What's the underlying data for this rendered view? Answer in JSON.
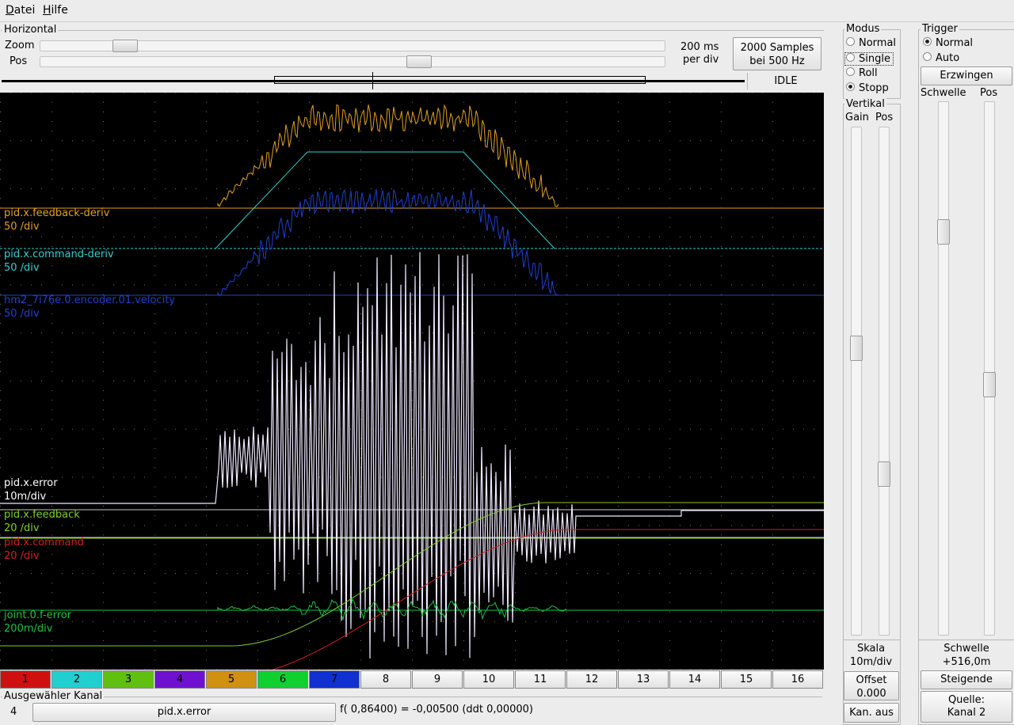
{
  "menu": {
    "datei": "Datei",
    "hilfe": "Hilfe"
  },
  "horizontal": {
    "title": "Horizontal",
    "zoom_label": "Zoom",
    "pos_label": "Pos",
    "zoom_level": 0.12,
    "pos_level": 0.61,
    "time_per_div_line1": "200 ms",
    "time_per_div_line2": "per div",
    "samples_line1": "2000 Samples",
    "samples_line2": "bei 500 Hz",
    "status": "IDLE"
  },
  "modus": {
    "title": "Modus",
    "options": [
      "Normal",
      "Single",
      "Roll",
      "Stopp"
    ],
    "selected": "Stopp"
  },
  "trigger": {
    "title": "Trigger",
    "options": [
      "Normal",
      "Auto"
    ],
    "selected": "Normal",
    "force_button": "Erzwingen",
    "threshold_label": "Schwelle",
    "pos_label": "Pos",
    "threshold_level": 0.77,
    "pos_level": 0.53,
    "threshold_title": "Schwelle",
    "threshold_value": "+516,0m",
    "edge_button": "Steigende",
    "source_line1": "Quelle:",
    "source_line2": "Kanal  2"
  },
  "vertikal": {
    "title": "Vertikal",
    "gain_label": "Gain",
    "pos_label": "Pos",
    "gain_level": 0.43,
    "pos_level": 0.69,
    "scale_label": "Skala",
    "scale_value": "10m/div",
    "offset_label": "Offset",
    "offset_value": "0.000",
    "channel_off_button": "Kan. aus"
  },
  "traces": [
    {
      "name": "pid.x.feedback-deriv",
      "scale": "50 /div",
      "color": "#e0a020"
    },
    {
      "name": "pid.x.command-deriv",
      "scale": "50 /div",
      "color": "#30d0d0"
    },
    {
      "name": "hm2_7i76e.0.encoder.01.velocity",
      "scale": "50 /div",
      "color": "#2040d0"
    },
    {
      "name": "pid.x.error",
      "scale": "10m/div",
      "color": "#ffffff"
    },
    {
      "name": "pid.x.feedback",
      "scale": "20 /div",
      "color": "#80d020"
    },
    {
      "name": "pid.x.command",
      "scale": "20 /div",
      "color": "#d02020"
    },
    {
      "name": "joint.0.f-error",
      "scale": "200m/div",
      "color": "#20c040"
    }
  ],
  "channels": [
    {
      "label": "1",
      "color": "#d01010"
    },
    {
      "label": "2",
      "color": "#20d0d0"
    },
    {
      "label": "3",
      "color": "#60c010"
    },
    {
      "label": "4",
      "color": "#7010d0"
    },
    {
      "label": "5",
      "color": "#d09010"
    },
    {
      "label": "6",
      "color": "#10d030"
    },
    {
      "label": "7",
      "color": "#1030d0"
    },
    {
      "label": "8",
      "color": "#f4f4f4"
    },
    {
      "label": "9",
      "color": "#f4f4f4"
    },
    {
      "label": "10",
      "color": "#f4f4f4"
    },
    {
      "label": "11",
      "color": "#f4f4f4"
    },
    {
      "label": "12",
      "color": "#f4f4f4"
    },
    {
      "label": "13",
      "color": "#f4f4f4"
    },
    {
      "label": "14",
      "color": "#f4f4f4"
    },
    {
      "label": "15",
      "color": "#f4f4f4"
    },
    {
      "label": "16",
      "color": "#f4f4f4"
    }
  ],
  "selected_channel": {
    "title": "Ausgewähler Kanal",
    "number": "4",
    "name": "pid.x.error",
    "readout": "f( 0,86400) = -0,00500 (ddt  0,00000)"
  }
}
